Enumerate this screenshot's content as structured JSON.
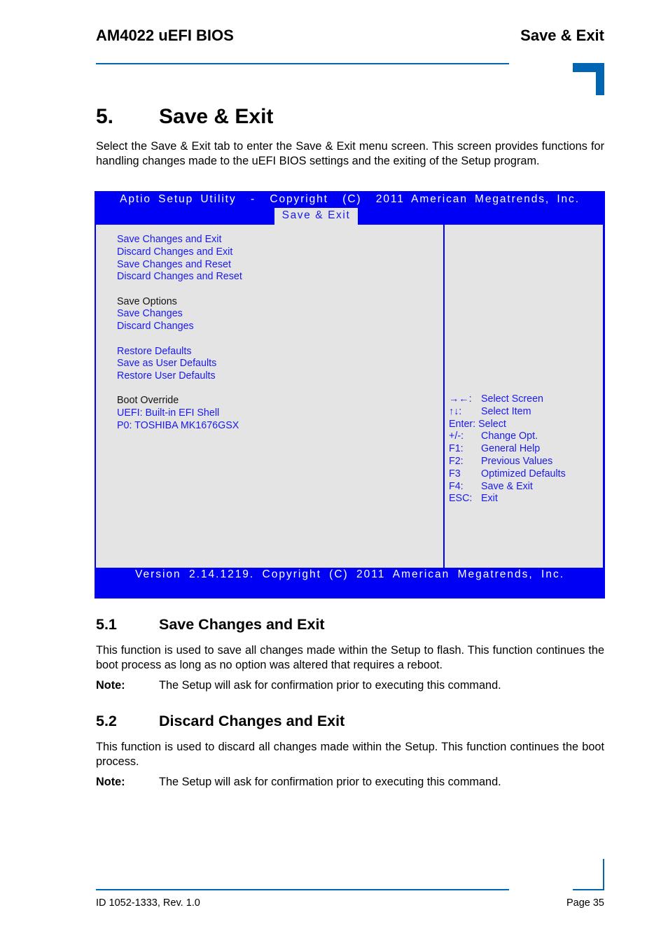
{
  "header": {
    "doc_title": "AM4022 uEFI BIOS",
    "section_title": "Save & Exit",
    "accent_color": "#0066b3"
  },
  "chapter": {
    "number": "5.",
    "title": "Save & Exit",
    "intro": "Select the Save & Exit tab to enter the Save & Exit menu screen. This screen provides functions for handling changes made to the uEFI BIOS settings and the exiting of the Setup program."
  },
  "bios": {
    "title": "Aptio Setup Utility  -  Copyright  (C)  2011 American Megatrends, Inc.",
    "active_tab": "Save & Exit",
    "menu": {
      "group1": [
        "Save Changes and Exit",
        "Discard Changes and Exit",
        "Save Changes and Reset",
        "Discard Changes and Reset"
      ],
      "save_options_label": "Save Options",
      "group2": [
        "Save Changes",
        "Discard Changes"
      ],
      "group3": [
        "Restore Defaults",
        "Save as User Defaults",
        "Restore User Defaults"
      ],
      "boot_override_label": "Boot Override",
      "group4": [
        "UEFI: Built-in EFI Shell",
        "P0: TOSHIBA MK1676GSX"
      ]
    },
    "help": [
      {
        "key": "→←:",
        "action": "Select Screen"
      },
      {
        "key": "↑↓:",
        "action": "Select Item"
      },
      {
        "key": "Enter:",
        "action": "Select"
      },
      {
        "key": "+/-:",
        "action": "Change Opt."
      },
      {
        "key": "F1:",
        "action": "General Help"
      },
      {
        "key": "F2:",
        "action": "Previous Values"
      },
      {
        "key": "F3",
        "action": "Optimized Defaults"
      },
      {
        "key": "F4:",
        "action": "Save & Exit"
      },
      {
        "key": "ESC:",
        "action": "Exit"
      }
    ],
    "version": "Version 2.14.1219. Copyright (C) 2011 American Megatrends, Inc.",
    "colors": {
      "frame": "#0000f5",
      "pane": "#e4e4e4",
      "item_text": "#1a1aee"
    }
  },
  "sections": [
    {
      "number": "5.1",
      "title": "Save Changes and Exit",
      "body": "This function is used to save all changes made within the Setup to flash. This function continues the boot process as long as no option was altered that requires a reboot.",
      "note_label": "Note:",
      "note_text": "The Setup will ask for confirmation prior to executing this command."
    },
    {
      "number": "5.2",
      "title": "Discard Changes and Exit",
      "body": "This function is used to discard all changes made within the Setup. This function continues the boot process.",
      "note_label": "Note:",
      "note_text": "The Setup will ask for confirmation prior to executing this command."
    }
  ],
  "footer": {
    "doc_id": "ID 1052-1333, Rev. 1.0",
    "page": "Page 35"
  }
}
